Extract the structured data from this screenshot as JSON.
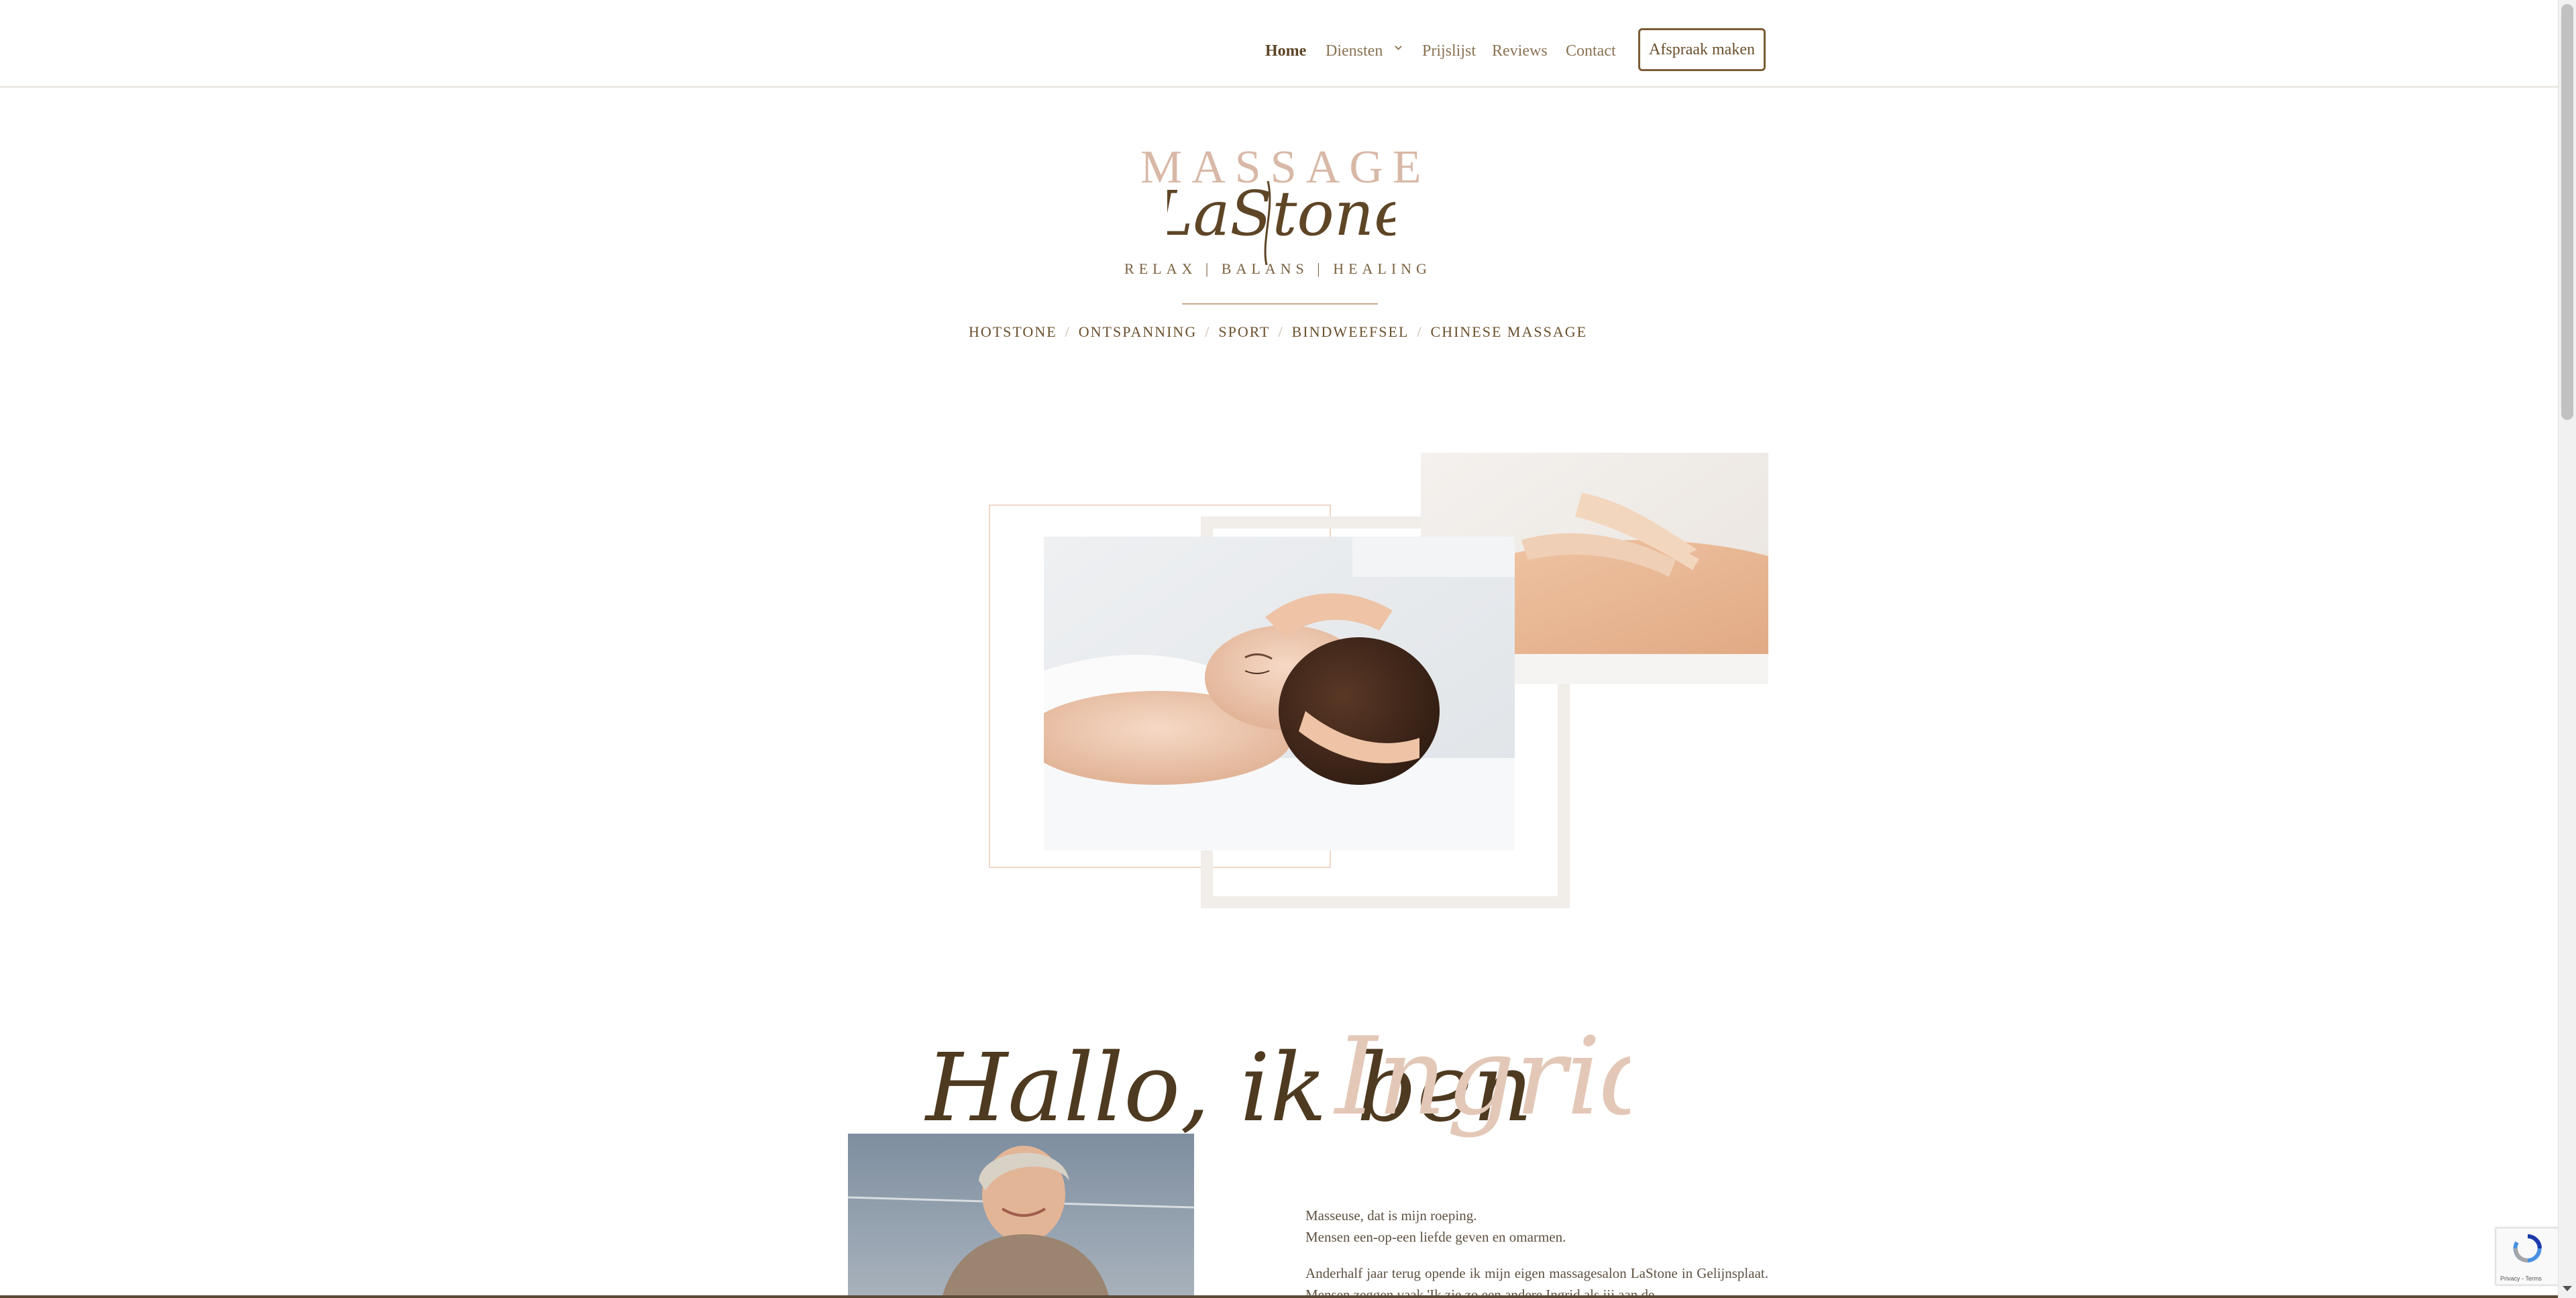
{
  "nav": {
    "items": [
      {
        "label": "Home",
        "active": true
      },
      {
        "label": "Diensten",
        "has_dropdown": true
      },
      {
        "label": "Prijslijst"
      },
      {
        "label": "Reviews"
      },
      {
        "label": "Contact"
      }
    ],
    "cta_label": "Afspraak maken"
  },
  "logo": {
    "word_top": "MASSAGE",
    "word_script": "LaStone",
    "tagline": "RELAX | BALANS | HEALING"
  },
  "services": [
    "HOTSTONE",
    "ONTSPANNING",
    "SPORT",
    "BINDWEEFSEL",
    "CHINESE MASSAGE"
  ],
  "services_separator": "/",
  "intro": {
    "heading_script": "Hallo, ik ben",
    "heading_name": "Ingrid",
    "line1": "Masseuse, dat is mijn roeping.",
    "line2": "Mensen een-op-een liefde geven en omarmen.",
    "paragraph": "Anderhalf jaar terug opende ik mijn eigen massagesalon LaStone in Gelijnsplaat. Mensen zeggen vaak 'Ik zie zo een andere Ingrid als jij aan de"
  },
  "recaptcha": {
    "terms": "Privacy - Terms"
  },
  "colors": {
    "brand_brown": "#6e5a3c",
    "accent_rose": "#d8b8a6",
    "frame_beige": "#f1ede8"
  }
}
